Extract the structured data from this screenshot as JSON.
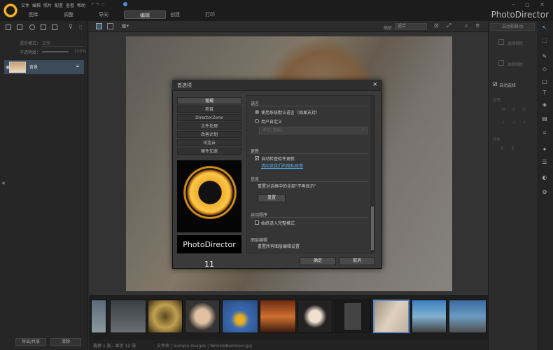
{
  "app": {
    "menus": [
      "文件",
      "编辑",
      "照片",
      "配置",
      "查看",
      "帮助"
    ],
    "tabs": [
      "图库",
      "调整",
      "导向",
      "编辑",
      "创建",
      "打印"
    ],
    "active_tab": "编辑",
    "brand": "PhotoDirector",
    "window_controls": "– ◻ ✕"
  },
  "left_panel": {
    "blend_label": "混合模式：",
    "blend_value": "正常",
    "opacity_label": "不透明度：",
    "opacity_value": "100%",
    "layer_name": "背景",
    "export_button": "导出/共享",
    "clear_button": "清除"
  },
  "viewbar": {
    "zoom_label": "缩放：",
    "zoom_value": "适合"
  },
  "right_panel": {
    "title": "自动和移动",
    "items": [
      "选择相框",
      "选择相框",
      "自动选择",
      "对齐",
      "分布"
    ]
  },
  "status": {
    "selection": "选择 1 张，显示 12 张",
    "path": "文件夹 | Sample Images | WrinkleRemover.jpg"
  },
  "dialog": {
    "title": "首选项",
    "close": "×",
    "nav": [
      "常规",
      "项目",
      "DirectorZone",
      "文件处理",
      "改善计划",
      "讯连云",
      "硬件加速"
    ],
    "brand": "PhotoDirector 11",
    "sections": {
      "language_title": "语言",
      "lang_default": "使用系统默认语言（如果支持）",
      "lang_custom": "用户自定义",
      "lang_select_placeholder": "中文(简体)",
      "update_title": "更新",
      "update_check": "自动检查软件更新",
      "update_link": "请阅读我们的隐私政策",
      "info_title": "信息",
      "info_text": "重置对话框中的全部\"不再显示\"",
      "reset_button": "重置",
      "startup_title": "启动程序",
      "startup_check": "始终进入完整模式",
      "layer_title": "图层编辑",
      "layer_text": "重置所有图层编辑设置"
    },
    "ok_button": "确定",
    "cancel_button": "取消"
  },
  "colors": {
    "accent": "#f3b030",
    "link": "#5ab0f0",
    "selected_layer": "#3c4a5a"
  }
}
